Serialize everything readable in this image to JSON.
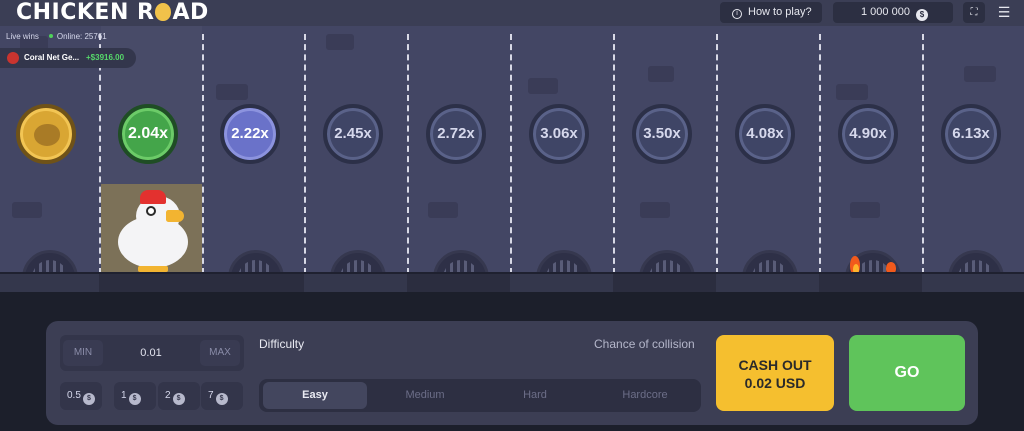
{
  "header": {
    "logo_left": "CHICKEN R",
    "logo_right": "AD",
    "how_to_play": "How to play?",
    "balance": "1 000 000",
    "currency_glyph": "$"
  },
  "live_wins": {
    "label": "Live wins",
    "online": "Online: 25761",
    "latest": {
      "user": "Coral Net Ge...",
      "amount": "+$3916.00"
    }
  },
  "lanes": {
    "multipliers": [
      "2.04x",
      "2.22x",
      "2.45x",
      "2.72x",
      "3.06x",
      "3.50x",
      "4.08x",
      "4.90x",
      "6.13x"
    ],
    "current_lane": 1,
    "fire_lane": 8
  },
  "bet": {
    "min_label": "MIN",
    "max_label": "MAX",
    "value": "0.01",
    "chips": [
      "0.5",
      "1",
      "2",
      "7"
    ]
  },
  "difficulty": {
    "label": "Difficulty",
    "chance_label": "Chance of collision",
    "options": [
      "Easy",
      "Medium",
      "Hard",
      "Hardcore"
    ],
    "selected": "Easy"
  },
  "actions": {
    "cashout_line1": "CASH OUT",
    "cashout_line2": "0.02 USD",
    "go": "GO"
  },
  "colors": {
    "road": "#434664",
    "cashout": "#f5bf2f",
    "go": "#5fc45b",
    "current_multiplier": "#44a54a",
    "passed_multiplier": "#6a72c9"
  }
}
